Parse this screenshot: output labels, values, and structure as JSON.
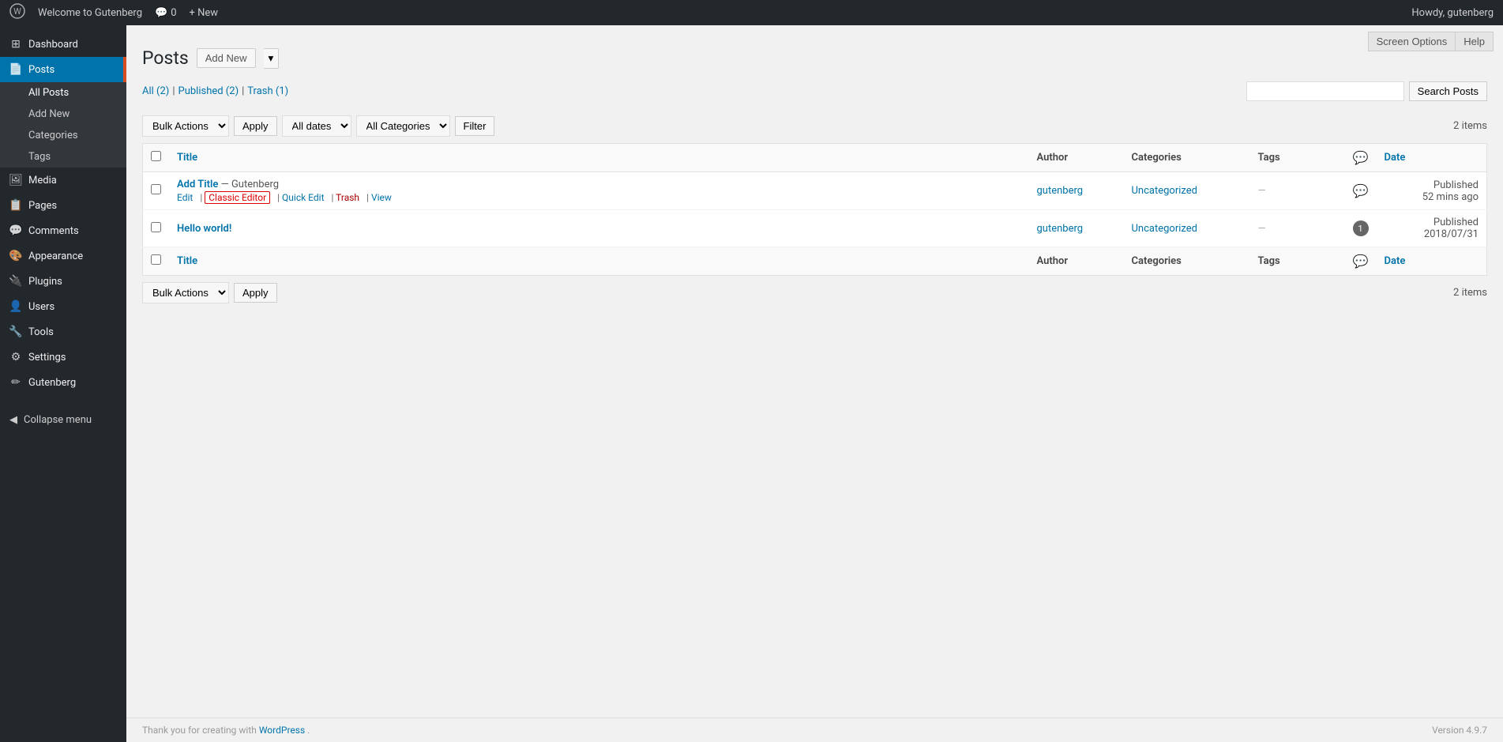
{
  "adminbar": {
    "wp_logo": "W",
    "site_name": "Welcome to Gutenberg",
    "comments_label": "Comments",
    "comments_count": "0",
    "new_label": "+ New",
    "howdy": "Howdy, gutenberg"
  },
  "sidebar": {
    "items": [
      {
        "id": "dashboard",
        "label": "Dashboard",
        "icon": "⊞"
      },
      {
        "id": "posts",
        "label": "Posts",
        "icon": "📄",
        "active": true
      },
      {
        "id": "media",
        "label": "Media",
        "icon": "🖼"
      },
      {
        "id": "pages",
        "label": "Pages",
        "icon": "📋"
      },
      {
        "id": "comments",
        "label": "Comments",
        "icon": "💬"
      },
      {
        "id": "appearance",
        "label": "Appearance",
        "icon": "🎨"
      },
      {
        "id": "plugins",
        "label": "Plugins",
        "icon": "🔌"
      },
      {
        "id": "users",
        "label": "Users",
        "icon": "👤"
      },
      {
        "id": "tools",
        "label": "Tools",
        "icon": "🔧"
      },
      {
        "id": "settings",
        "label": "Settings",
        "icon": "⚙"
      },
      {
        "id": "gutenberg",
        "label": "Gutenberg",
        "icon": "✏"
      }
    ],
    "submenu_posts": [
      {
        "id": "all-posts",
        "label": "All Posts",
        "active": true
      },
      {
        "id": "add-new",
        "label": "Add New"
      },
      {
        "id": "categories",
        "label": "Categories"
      },
      {
        "id": "tags",
        "label": "Tags"
      }
    ],
    "collapse_label": "Collapse menu"
  },
  "topbar": {
    "screen_options": "Screen Options",
    "help": "Help"
  },
  "page": {
    "title": "Posts",
    "add_new_label": "Add New"
  },
  "subsubsub": {
    "all_label": "All",
    "all_count": "(2)",
    "published_label": "Published",
    "published_count": "(2)",
    "trash_label": "Trash",
    "trash_count": "(1)"
  },
  "filters": {
    "bulk_actions_label": "Bulk Actions",
    "apply_label": "Apply",
    "all_dates_label": "All dates",
    "all_categories_label": "All Categories",
    "filter_label": "Filter",
    "items_count": "2 items"
  },
  "search": {
    "placeholder": "",
    "button_label": "Search Posts"
  },
  "table": {
    "headers": {
      "title": "Title",
      "author": "Author",
      "categories": "Categories",
      "tags": "Tags",
      "date": "Date"
    },
    "rows": [
      {
        "id": 1,
        "title": "Add Title",
        "title_suffix": "— Gutenberg",
        "author": "gutenberg",
        "categories": "Uncategorized",
        "tags": "—",
        "comments": "",
        "comments_icon": "bubble",
        "date_status": "Published",
        "date_value": "52 mins ago",
        "row_actions": {
          "edit": "Edit",
          "classic_editor": "Classic Editor",
          "quick_edit": "Quick Edit",
          "trash": "Trash",
          "view": "View"
        }
      },
      {
        "id": 2,
        "title": "Hello world!",
        "title_suffix": "",
        "author": "gutenberg",
        "categories": "Uncategorized",
        "tags": "—",
        "comments": "1",
        "comments_icon": "count",
        "date_status": "Published",
        "date_value": "2018/07/31",
        "row_actions": {}
      }
    ]
  },
  "footer": {
    "thank_you_text": "Thank you for creating with",
    "wordpress_link": "WordPress",
    "version": "Version 4.9.7"
  }
}
